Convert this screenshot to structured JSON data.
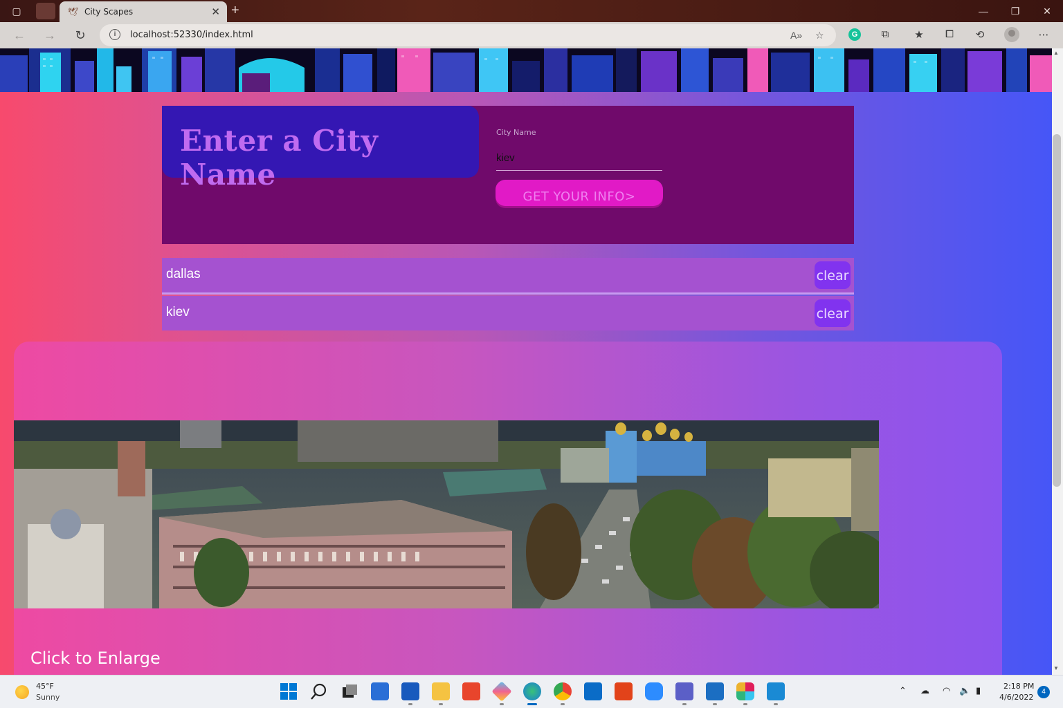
{
  "browser": {
    "tab_title": "City Scapes",
    "url": "localhost:52330/index.html"
  },
  "form": {
    "heading": "Enter a City Name",
    "field_label": "City Name",
    "field_value": "kiev",
    "submit_label": "GET YOUR INFO>"
  },
  "history": [
    {
      "city": "dallas",
      "clear_label": "clear"
    },
    {
      "city": "kiev",
      "clear_label": "clear"
    }
  ],
  "card": {
    "enlarge_label": "Click to Enlarge"
  },
  "taskbar": {
    "weather_temp": "45°F",
    "weather_condition": "Sunny",
    "time": "2:18 PM",
    "date": "4/6/2022",
    "notification_count": "4"
  },
  "colors": {
    "form_panel": "#700a6b",
    "heading_box": "#3417b3",
    "heading_text": "#c06bf0",
    "submit_button": "#e11ac6",
    "history_row": "#a552d0",
    "clear_button": "#8133ef"
  }
}
